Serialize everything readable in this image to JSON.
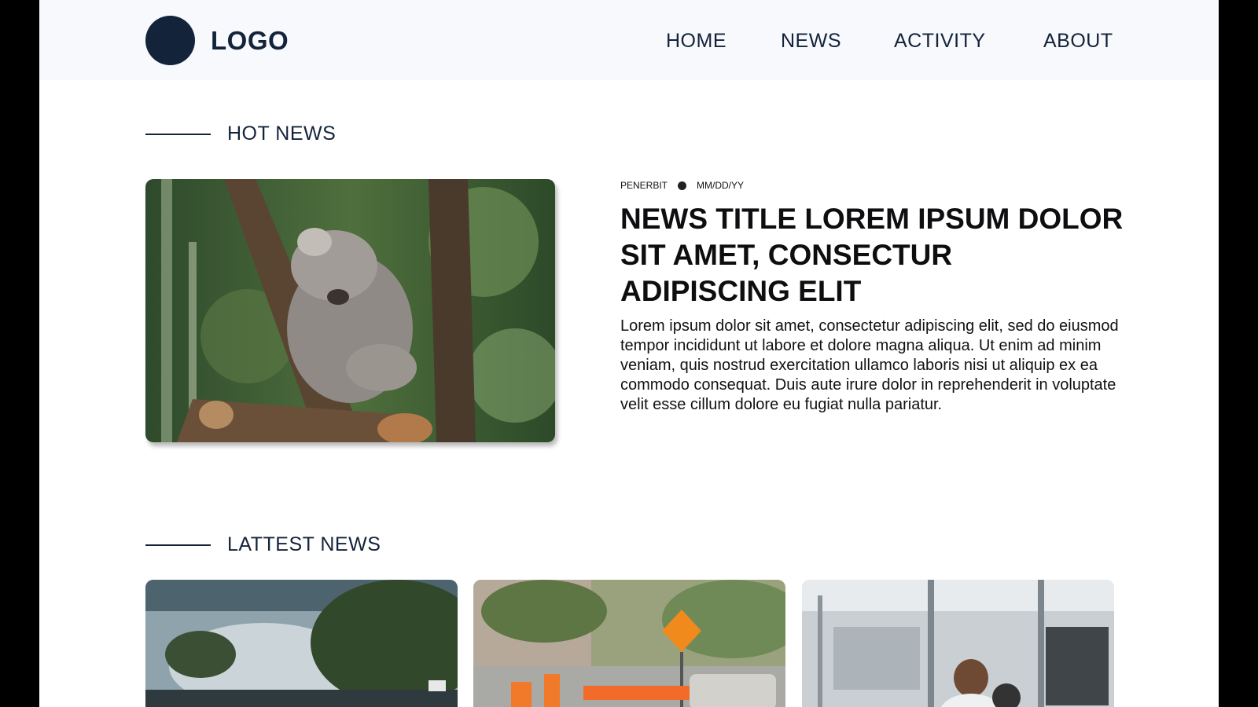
{
  "header": {
    "logo_text": "LOGO",
    "nav": [
      {
        "label": "HOME"
      },
      {
        "label": "NEWS"
      },
      {
        "label": "ACTIVITY"
      },
      {
        "label": "ABOUT"
      }
    ]
  },
  "hot_news": {
    "section_title": "HOT NEWS",
    "publisher": "PENERBIT",
    "date": "MM/DD/YY",
    "title": "NEWS TITLE LOREM IPSUM DOLOR SIT AMET, CONSECTUR ADIPISCING ELIT",
    "body": "Lorem ipsum dolor sit amet, consectetur adipiscing elit, sed do eiusmod tempor incididunt ut labore et dolore magna aliqua. Ut enim ad minim veniam, quis nostrud exercitation ullamco laboris nisi ut aliquip ex ea commodo consequat. Duis aute irure dolor in reprehenderit in voluptate velit esse cillum dolore eu fugiat nulla pariatur.",
    "image": "koala-in-tree-photo"
  },
  "latest_news": {
    "section_title": "LATTEST NEWS",
    "cards": [
      {
        "image": "street-smoke-trees-photo"
      },
      {
        "image": "road-construction-sign-photo"
      },
      {
        "image": "lab-engineer-photo"
      }
    ]
  },
  "colors": {
    "brand_dark": "#13233a",
    "header_bg": "#f7f9fc"
  }
}
